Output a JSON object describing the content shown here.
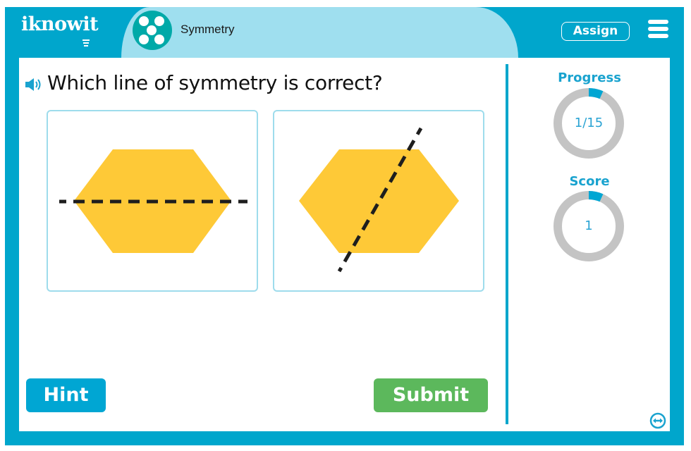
{
  "header": {
    "logo_text": "iknowit",
    "topic_title": "Symmetry",
    "topic_icon": "five-dots-icon",
    "assign_label": "Assign",
    "menu_icon": "hamburger-menu-icon"
  },
  "question": {
    "audio_icon": "speaker-icon",
    "text": "Which line of symmetry is correct?"
  },
  "choices": [
    {
      "id": "choice-horizontal-line",
      "shape": "hexagon",
      "line": "horizontal-dashed",
      "fill_color": "#fec937"
    },
    {
      "id": "choice-diagonal-line",
      "shape": "hexagon",
      "line": "diagonal-dashed",
      "fill_color": "#fec937"
    }
  ],
  "buttons": {
    "hint_label": "Hint",
    "submit_label": "Submit"
  },
  "sidebar": {
    "progress_label": "Progress",
    "progress_value": "1/15",
    "progress_fraction": 0.0667,
    "score_label": "Score",
    "score_value": "1",
    "score_fraction": 0.0667,
    "expand_icon": "expand-horizontal-icon"
  },
  "colors": {
    "frame": "#00a6cc",
    "tab": "#9fdfef",
    "accent": "#1aa3cf",
    "submit": "#5cb85c",
    "hint": "#00a6d3",
    "ring_track": "#c4c4c4",
    "ring_fill": "#00a6d3"
  }
}
